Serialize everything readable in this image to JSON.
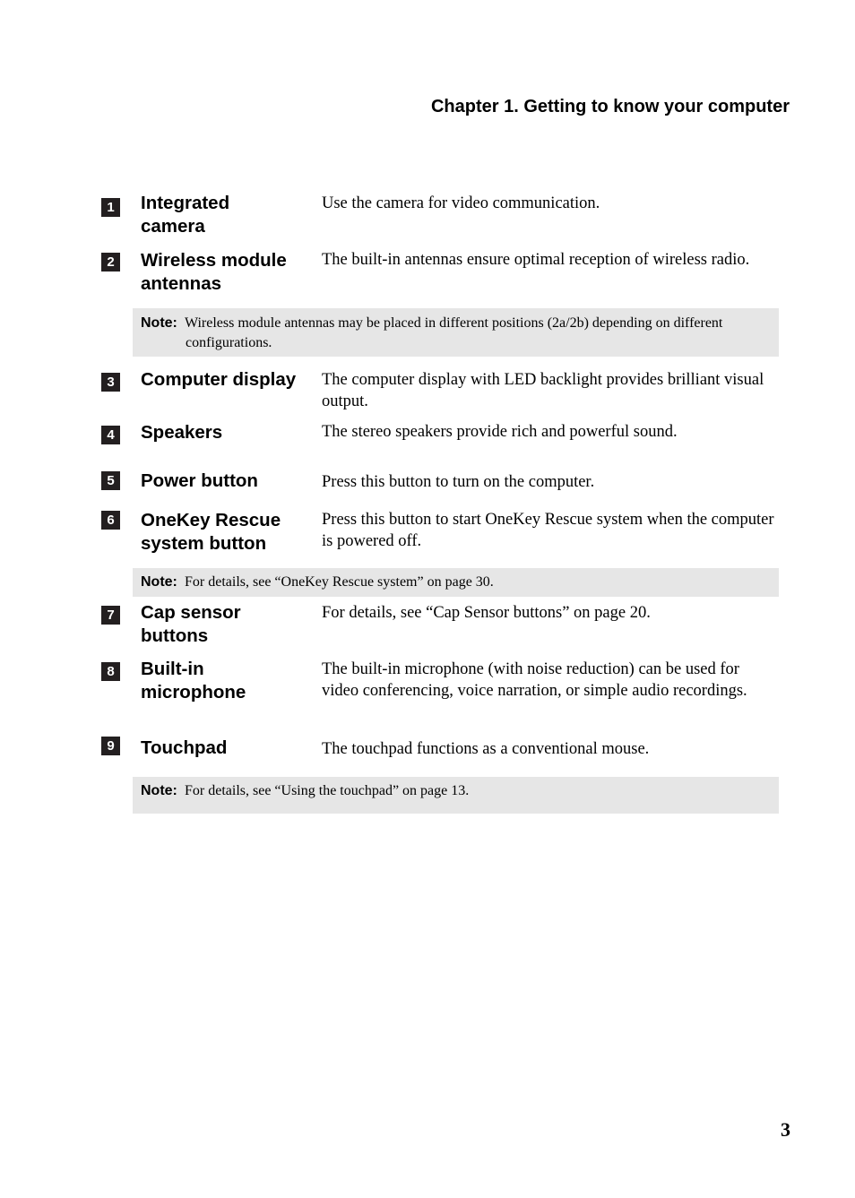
{
  "header": {
    "chapter_title": "Chapter 1. Getting to know your computer"
  },
  "items": [
    {
      "number": "1",
      "term": "Integrated camera",
      "description": "Use the camera for video communication."
    },
    {
      "number": "2",
      "term": "Wireless module antennas",
      "description": "The built-in antennas ensure optimal reception of wireless radio."
    },
    {
      "number": "3",
      "term": "Computer display",
      "description": "The computer display with LED backlight provides brilliant visual output."
    },
    {
      "number": "4",
      "term": "Speakers",
      "description": "The stereo speakers provide rich and powerful sound."
    },
    {
      "number": "5",
      "term": "Power button",
      "description": "Press this button to turn on the computer."
    },
    {
      "number": "6",
      "term": "OneKey Rescue system button",
      "description": "Press this button to start OneKey Rescue system when the computer is powered off."
    },
    {
      "number": "7",
      "term": "Cap sensor buttons",
      "description": "For details, see “Cap Sensor buttons” on page 20."
    },
    {
      "number": "8",
      "term": "Built-in microphone",
      "description": "The built-in microphone (with noise reduction) can be used for video conferencing, voice narration, or simple audio recordings."
    },
    {
      "number": "9",
      "term": "Touchpad",
      "description": "The touchpad functions as a conventional mouse."
    }
  ],
  "notes": [
    {
      "label": "Note:",
      "text": "Wireless module antennas may be placed in different positions (2a/2b) depending on different configurations."
    },
    {
      "label": "Note:",
      "text": "For details, see “OneKey Rescue system” on page 30."
    },
    {
      "label": "Note:",
      "text": "For details, see “Using the touchpad” on page 13."
    }
  ],
  "footer": {
    "page_number": "3"
  }
}
